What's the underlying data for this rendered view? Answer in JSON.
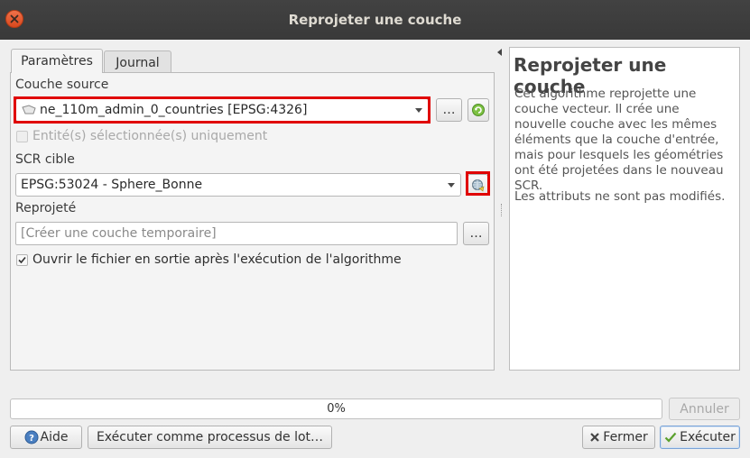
{
  "window": {
    "title": "Reprojeter une couche"
  },
  "tabs": [
    {
      "label": "Paramètres"
    },
    {
      "label": "Journal"
    }
  ],
  "form": {
    "source_label": "Couche source",
    "source_value": "ne_110m_admin_0_countries [EPSG:4326]",
    "browse_label": "…",
    "selected_only_label": "Entité(s) sélectionnée(s) uniquement",
    "crs_label": "SCR cible",
    "crs_value": "EPSG:53024 - Sphere_Bonne",
    "output_label": "Reprojeté",
    "output_placeholder": "[Créer une couche temporaire]",
    "output_browse_label": "…",
    "open_after_label": "Ouvrir le fichier en sortie après l'exécution de l'algorithme"
  },
  "help": {
    "title": "Reprojeter une couche",
    "description": "Cet algorithme reprojette une couche vecteur. Il crée une nouvelle couche avec les mêmes éléments que la couche d'entrée, mais pour lesquels les géométries ont été projetées dans le nouveau SCR.",
    "note": "Les attributs ne sont pas modifiés."
  },
  "progress": {
    "text": "0%",
    "value_percent": 0
  },
  "buttons": {
    "cancel": "Annuler",
    "help": "Aide",
    "batch": "Exécuter comme processus de lot…",
    "close": "Fermer",
    "run": "Exécuter"
  },
  "colors": {
    "highlight": "#e00000",
    "titlebar": "#3e3e3e",
    "close_button": "#e55b2f"
  }
}
